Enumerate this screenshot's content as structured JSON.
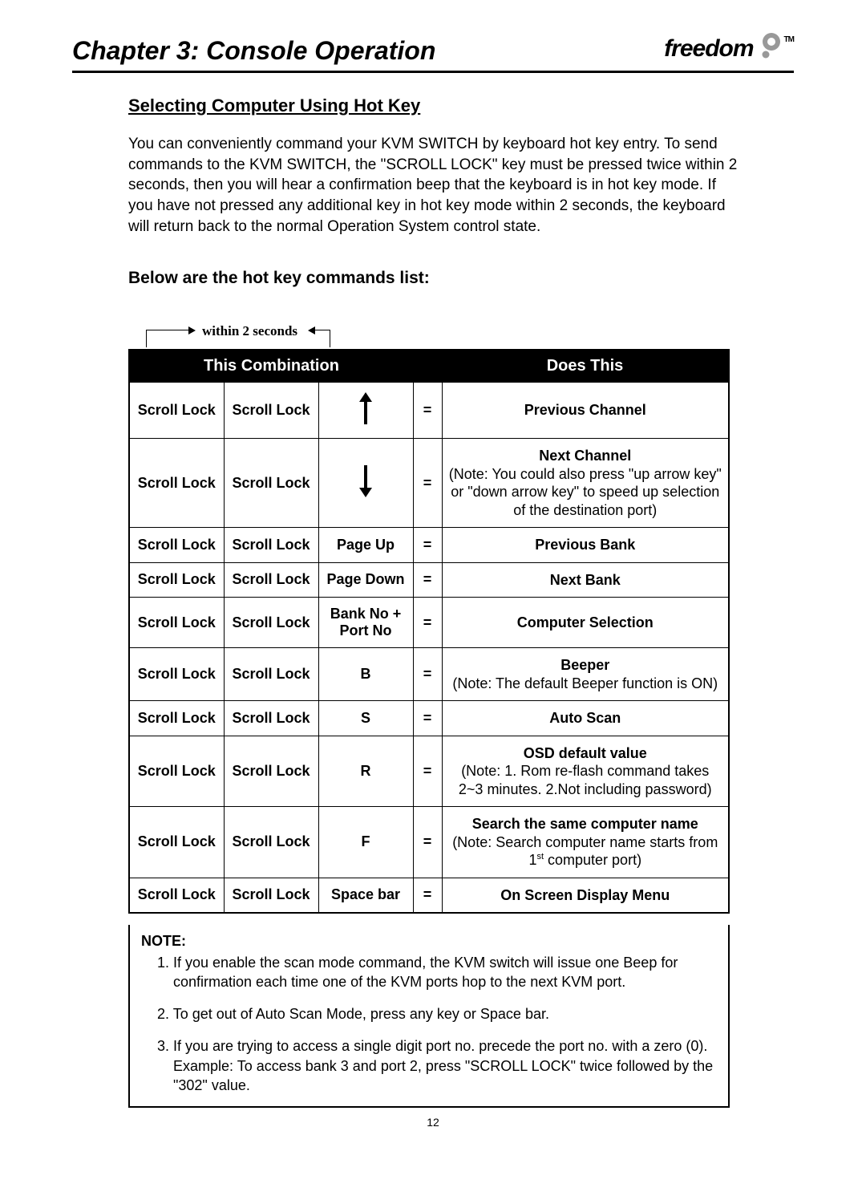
{
  "header": {
    "chapter": "Chapter 3: Console Operation",
    "brand": "freedom",
    "brand_tm": "TM"
  },
  "section": {
    "title": "Selecting Computer Using Hot Key",
    "intro": "You can conveniently command your KVM SWITCH by keyboard hot key entry. To send commands to the KVM SWITCH, the \"SCROLL LOCK\" key must be pressed twice within 2 seconds, then you will hear a confirmation beep that the keyboard is in hot key mode. If you have not pressed any additional key in hot key mode within 2 seconds, the keyboard will return back to the normal Operation System control state.",
    "subhead": "Below are the hot key commands list:",
    "timing_label": "within 2 seconds"
  },
  "table": {
    "head_combo": "This Combination",
    "head_does": "Does This",
    "eq": "=",
    "rows": [
      {
        "k1": "Scroll Lock",
        "k2": "Scroll Lock",
        "k3_icon": "arrow-up",
        "k3": "",
        "desc_bold": "Previous Channel",
        "desc_note": ""
      },
      {
        "k1": "Scroll Lock",
        "k2": "Scroll Lock",
        "k3_icon": "arrow-down",
        "k3": "",
        "desc_bold": "Next Channel",
        "desc_note": "(Note: You could also press \"up arrow key\" or \"down arrow key\" to speed up selection of the destination port)"
      },
      {
        "k1": "Scroll Lock",
        "k2": "Scroll Lock",
        "k3_icon": "",
        "k3": "Page Up",
        "desc_bold": "Previous Bank",
        "desc_note": ""
      },
      {
        "k1": "Scroll Lock",
        "k2": "Scroll Lock",
        "k3_icon": "",
        "k3": "Page Down",
        "desc_bold": "Next Bank",
        "desc_note": ""
      },
      {
        "k1": "Scroll Lock",
        "k2": "Scroll Lock",
        "k3_icon": "",
        "k3": "Bank No + Port No",
        "desc_bold": "Computer Selection",
        "desc_note": ""
      },
      {
        "k1": "Scroll Lock",
        "k2": "Scroll Lock",
        "k3_icon": "",
        "k3": "B",
        "desc_bold": "Beeper",
        "desc_note": "(Note: The default Beeper function is ON)"
      },
      {
        "k1": "Scroll Lock",
        "k2": "Scroll Lock",
        "k3_icon": "",
        "k3": "S",
        "desc_bold": "Auto Scan",
        "desc_note": ""
      },
      {
        "k1": "Scroll Lock",
        "k2": "Scroll Lock",
        "k3_icon": "",
        "k3": "R",
        "desc_bold": "OSD default value",
        "desc_note": "(Note: 1. Rom re-flash command takes 2~3 minutes. 2.Not including password)"
      },
      {
        "k1": "Scroll Lock",
        "k2": "Scroll Lock",
        "k3_icon": "",
        "k3": "F",
        "desc_bold": "Search the same computer name",
        "desc_note_html": "(Note: Search computer name starts from 1<span class=\"sup\">st</span> computer port)"
      },
      {
        "k1": "Scroll Lock",
        "k2": "Scroll Lock",
        "k3_icon": "",
        "k3": "Space bar",
        "desc_bold": "On Screen Display Menu",
        "desc_note": ""
      }
    ]
  },
  "notes": {
    "head": "NOTE:",
    "items": [
      "1. If you enable the scan mode command, the KVM switch will issue one Beep for confirmation each time one of the KVM ports hop to the next KVM port.",
      "2. To get out of Auto Scan Mode, press any key or Space bar.",
      "3. If you are trying to access a single digit port no. precede the port no. with a zero (0). Example: To access bank 3 and port 2, press \"SCROLL LOCK\" twice followed by the \"302\" value."
    ]
  },
  "pagenum": "12"
}
